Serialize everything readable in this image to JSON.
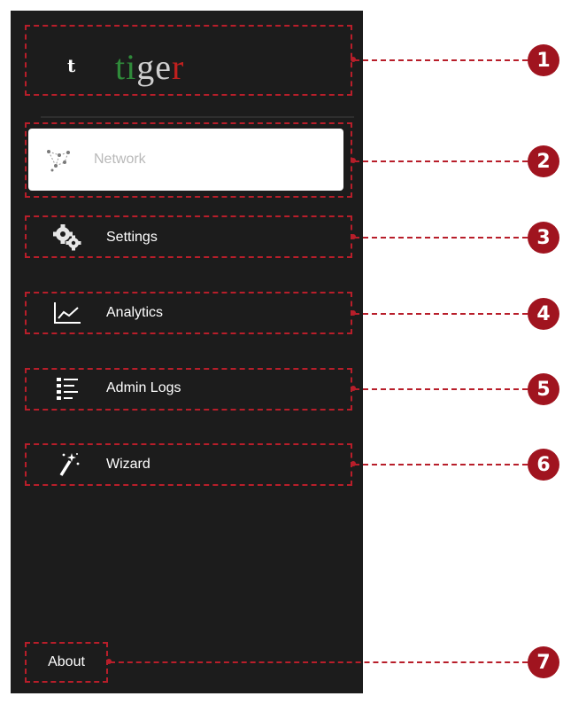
{
  "brand": {
    "mark": "t",
    "word_parts": [
      {
        "text": "ti",
        "color": "#2f8a3a"
      },
      {
        "text": "ge",
        "color": "#cfcfcf"
      },
      {
        "text": "r",
        "color": "#c0201e"
      }
    ]
  },
  "nav": {
    "items": [
      {
        "label": "Network",
        "icon": "network-icon",
        "active": true
      },
      {
        "label": "Settings",
        "icon": "gears-icon",
        "active": false
      },
      {
        "label": "Analytics",
        "icon": "line-chart-icon",
        "active": false
      },
      {
        "label": "Admin Logs",
        "icon": "list-icon",
        "active": false
      },
      {
        "label": "Wizard",
        "icon": "magic-wand-icon",
        "active": false
      }
    ]
  },
  "footer": {
    "about_label": "About"
  },
  "callouts": [
    "1",
    "2",
    "3",
    "4",
    "5",
    "6",
    "7"
  ],
  "colors": {
    "annotation": "#b81e2a",
    "badge": "#a0141f",
    "sidebar_bg": "#1c1c1c"
  }
}
